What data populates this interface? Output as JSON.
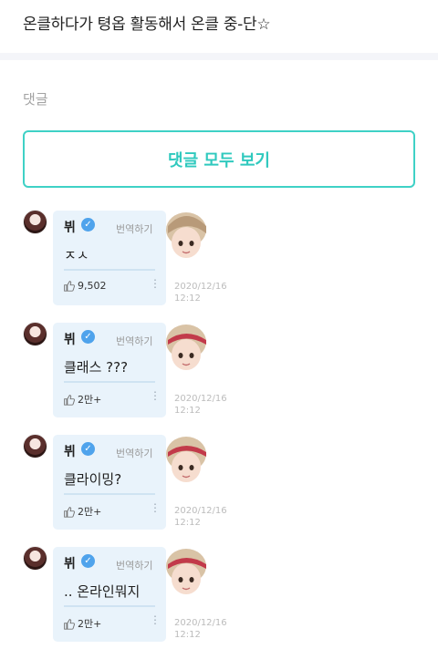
{
  "post": {
    "text": "온클하다가 텽옵 활동해서 온클 중-단☆"
  },
  "comments_section": {
    "label": "댓글",
    "view_all_label": "댓글 모두 보기"
  },
  "comments": [
    {
      "author": "뷔",
      "verified_mark": "✓",
      "translate_label": "번역하기",
      "text": "ㅈㅅ",
      "likes": "9,502",
      "date": "2020/12/16",
      "time": "12:12",
      "more": "⋮"
    },
    {
      "author": "뷔",
      "verified_mark": "✓",
      "translate_label": "번역하기",
      "text": "클래스 ???",
      "likes": "2만+",
      "date": "2020/12/16",
      "time": "12:12",
      "more": "⋮"
    },
    {
      "author": "뷔",
      "verified_mark": "✓",
      "translate_label": "번역하기",
      "text": "클라이밍?",
      "likes": "2만+",
      "date": "2020/12/16",
      "time": "12:12",
      "more": "⋮"
    },
    {
      "author": "뷔",
      "verified_mark": "✓",
      "translate_label": "번역하기",
      "text": ".. 온라인뭐지",
      "likes": "2만+",
      "date": "2020/12/16",
      "time": "12:12",
      "more": "⋮"
    }
  ],
  "icons": {
    "like": "thumbs-up-icon",
    "more": "more-vertical-icon",
    "verified": "verified-check-icon"
  },
  "colors": {
    "accent": "#2fc9be",
    "bubble": "#e9f3fb",
    "verified": "#4fa3ec"
  }
}
